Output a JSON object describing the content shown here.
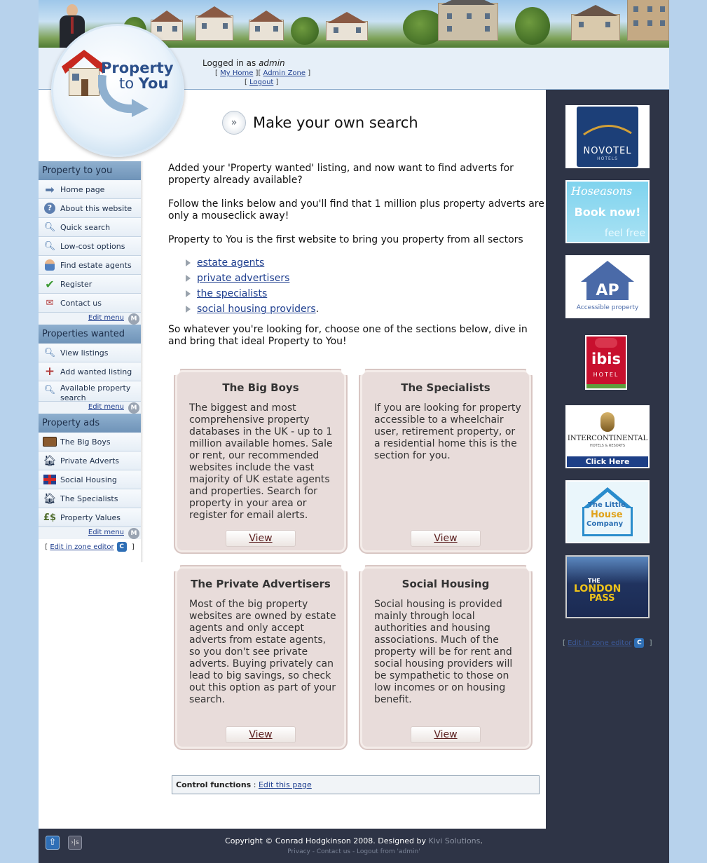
{
  "header": {
    "logo_line1": "Property",
    "logo_line2_prefix": "to",
    "logo_line2_bold": "You"
  },
  "login": {
    "prefix": "Logged in as",
    "user": "admin",
    "my_home": "My Home",
    "admin_zone": "Admin Zone",
    "logout": "Logout"
  },
  "sidebar": {
    "sections": [
      {
        "title": "Property to you",
        "items": [
          {
            "label": "Home page",
            "icon": "arrow-right-icon"
          },
          {
            "label": "About this website",
            "icon": "help-icon"
          },
          {
            "label": "Quick search",
            "icon": "magnifier-icon"
          },
          {
            "label": "Low-cost options",
            "icon": "magnifier-icon"
          },
          {
            "label": "Find estate agents",
            "icon": "person-icon"
          },
          {
            "label": "Register",
            "icon": "checkmark-icon"
          },
          {
            "label": "Contact us",
            "icon": "mail-icon"
          }
        ]
      },
      {
        "title": "Properties wanted",
        "items": [
          {
            "label": "View listings",
            "icon": "magnifier-icon"
          },
          {
            "label": "Add wanted listing",
            "icon": "plus-icon"
          },
          {
            "label": "Available property search",
            "icon": "magnifier-icon"
          }
        ]
      },
      {
        "title": "Property ads",
        "items": [
          {
            "label": "The Big Boys",
            "icon": "briefcase-icon"
          },
          {
            "label": "Private Adverts",
            "icon": "house-person-icon"
          },
          {
            "label": "Social Housing",
            "icon": "union-flag-icon"
          },
          {
            "label": "The Specialists",
            "icon": "house-person-icon"
          },
          {
            "label": "Property Values",
            "icon": "money-icon"
          }
        ]
      }
    ],
    "edit_menu": "Edit menu",
    "zone_editor": "Edit in zone editor"
  },
  "main": {
    "heading": "Make your own search",
    "para1": "Added your 'Property wanted' listing, and now want to find adverts for property already available?",
    "para2": "Follow the links below and you'll find that 1 million plus property adverts are only a mouseclick away!",
    "para3": "Property to You is the first website to bring you property from all sectors",
    "links": [
      "estate agents",
      "private advertisers",
      "the specialists",
      "social housing providers"
    ],
    "link_suffix": ".",
    "para4": "So whatever you're looking for, choose one of the sections below, dive in and bring that ideal Property to You!",
    "cards": [
      {
        "title": "The Big Boys",
        "text": "The biggest and most comprehensive property databases in the UK - up to 1 million available homes. Sale or rent, our recommended websites include the vast majority of UK estate agents and properties. Search for property in your area or register for email alerts.",
        "button": "View"
      },
      {
        "title": "The Specialists",
        "text": "If you are looking for property accessible to a wheelchair user, retirement property, or a residential home this is the section for you.",
        "button": "View"
      },
      {
        "title": "The Private Advertisers",
        "text": "Most of the big property websites are owned by estate agents and only accept adverts from estate agents, so you don't see private adverts. Buying privately can lead to big savings, so check out this option as part of your search.",
        "button": "View"
      },
      {
        "title": "Social Housing",
        "text": "Social housing is provided mainly through local authorities and housing associations. Much of the property will be for rent and social housing providers will be sympathetic to those on low incomes or on housing benefit.",
        "button": "View"
      }
    ],
    "control_label": "Control functions",
    "control_sep": ":",
    "control_link": "Edit this page"
  },
  "ads": {
    "novotel": {
      "name": "NOVOTEL",
      "sub": "HOTELS"
    },
    "hoseasons": {
      "name": "Hoseasons",
      "cta": "Book now!",
      "tag": "feel free"
    },
    "ap": {
      "mark": "AP",
      "name": "Accessible property"
    },
    "ibis": {
      "name": "ibis",
      "sub": "HOTEL"
    },
    "intercontinental": {
      "name": "INTERCONTINENTAL",
      "sub": "HOTELS & RESORTS",
      "cta": "Click Here"
    },
    "littlehouse": {
      "line1": "The Little",
      "line2": "House",
      "line3": "Company"
    },
    "londonpass": {
      "line1": "THE",
      "line2": "LONDON",
      "line3": "PASS"
    },
    "zone_editor": "Edit in zone editor"
  },
  "footer": {
    "copyright": "Copyright © Conrad Hodgkinson 2008. Designed by",
    "designer": "Kivi Solutions",
    "end": ".",
    "links": "Privacy - Contact us - Logout from 'admin'"
  },
  "colors": {
    "page_bg": "#b7d2ec",
    "dark_panel": "#2e3446",
    "card_bg": "#e8dcda",
    "sidebar_head": "#7e9fc3",
    "link": "#1f3f8f"
  }
}
